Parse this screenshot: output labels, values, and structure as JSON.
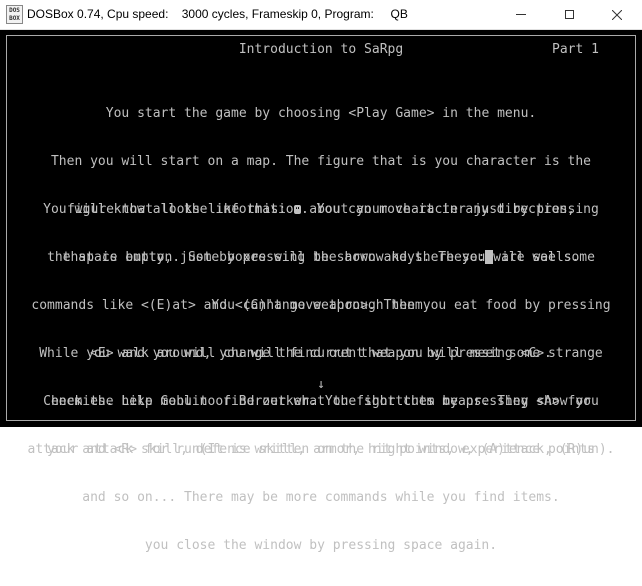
{
  "window": {
    "title": "DOSBox 0.74, Cpu speed:    3000 cycles, Frameskip 0, Program:     QB",
    "icon_label": "DOS BOX",
    "minimize_icon": "minimize-icon",
    "maximize_icon": "maximize-icon",
    "close_icon": "close-icon"
  },
  "screen": {
    "heading": "Introduction to SaRpg",
    "part": "Part 1",
    "para1": [
      "You start the game by choosing <Play Game> in the menu.",
      "Then you will start on a map. The figure that is you character is the",
      ". You can move it in any direction,",
      "that is empty, just by pressing the arrow keys. These:",
      " are walls.",
      "You can't move through them."
    ],
    "para1_figure_prefix": "figure that looks like this: ",
    "para2": [
      "You will know all the information about your character just by pressing",
      "the space button. Some boxes will be shown and there you will see some",
      "commands like <(E)at> and <(C)hange weapon>. Then you eat food by pressing",
      "<E> and you will change the current weapon by pressing <C>.",
      "Check the help menu to find out what the shortcuts means. They show you",
      "your attack skill, defence skill, armor, hit points, experience points",
      "and so on... There may be more commands while you find items.",
      "you close the window by pressing space again."
    ],
    "para3": [
      "While you walk around, you will find out that you will meet some strange",
      "enemies. Like Goblin or Berzerker. You fight them by pressing <A> for",
      "attack and <R> for run(It is written on the right window, (A)ttack, (R)un)."
    ],
    "scroll_arrow": "↓",
    "figure_icon": "smiley-face-icon",
    "wall_icon": "wall-block-icon"
  },
  "colors": {
    "screen_bg": "#000000",
    "text": "#c0c0c0",
    "frame": "#aaaaaa",
    "titlebar_bg": "#ffffff"
  }
}
